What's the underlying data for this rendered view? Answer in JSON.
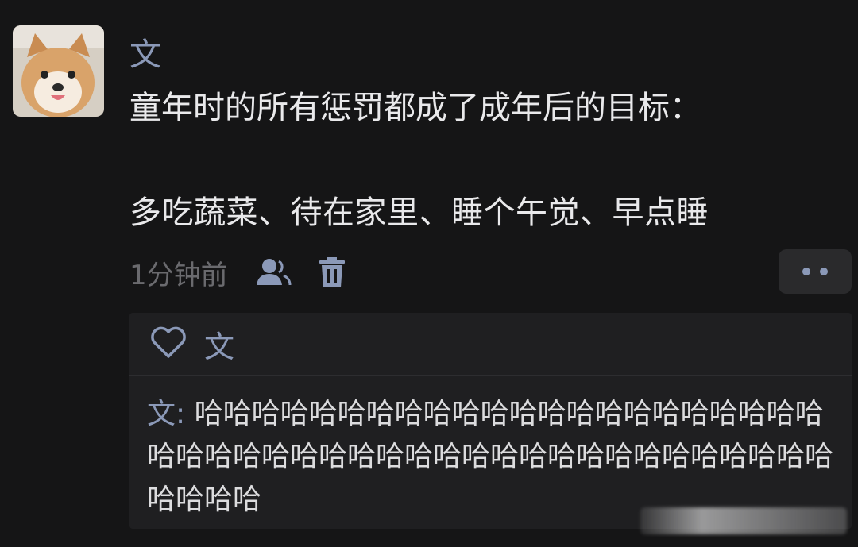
{
  "post": {
    "author": "文",
    "text_line1": "童年时的所有惩罚都成了成年后的目标：",
    "text_line2": "多吃蔬菜、待在家里、睡个午觉、早点睡",
    "time": "1分钟前"
  },
  "likes": {
    "names": "文"
  },
  "comment": {
    "author": "文",
    "separator": ": ",
    "text": "哈哈哈哈哈哈哈哈哈哈哈哈哈哈哈哈哈哈哈哈哈哈哈哈哈哈哈哈哈哈哈哈哈哈哈哈哈哈哈哈哈哈哈哈哈哈哈哈哈哈"
  },
  "colors": {
    "background": "#151516",
    "name_accent": "#8b99b8",
    "panel": "#1f1f21",
    "body_text": "#e9e9eb",
    "muted_text": "#6a6a6e"
  },
  "icons": {
    "visibility": "people-icon",
    "delete": "trash-icon",
    "like": "heart-outline-icon",
    "more": "more-dots-icon"
  }
}
